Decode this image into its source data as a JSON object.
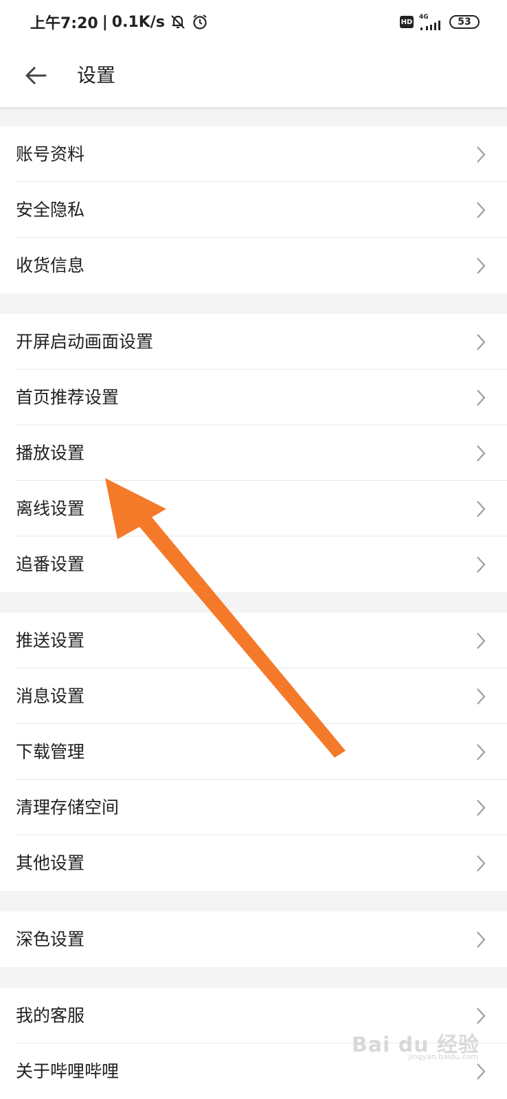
{
  "status_bar": {
    "time": "上午7:20",
    "separator": "|",
    "speed": "0.1K/s",
    "hd": "HD",
    "network": "4G",
    "battery": "53"
  },
  "header": {
    "title": "设置"
  },
  "groups": [
    {
      "items": [
        {
          "label": "账号资料"
        },
        {
          "label": "安全隐私"
        },
        {
          "label": "收货信息"
        }
      ]
    },
    {
      "items": [
        {
          "label": "开屏启动画面设置"
        },
        {
          "label": "首页推荐设置"
        },
        {
          "label": "播放设置"
        },
        {
          "label": "离线设置"
        },
        {
          "label": "追番设置"
        }
      ]
    },
    {
      "items": [
        {
          "label": "推送设置"
        },
        {
          "label": "消息设置"
        },
        {
          "label": "下载管理"
        },
        {
          "label": "清理存储空间"
        },
        {
          "label": "其他设置"
        }
      ]
    },
    {
      "items": [
        {
          "label": "深色设置"
        }
      ]
    },
    {
      "items": [
        {
          "label": "我的客服"
        },
        {
          "label": "关于哔哩哔哩"
        }
      ]
    }
  ],
  "watermark": {
    "brand": "Bai du 经验",
    "url": "jingyan.baidu.com"
  },
  "colors": {
    "arrow": "#f47a2a",
    "background": "#f4f4f4",
    "chevron": "#9e9e9e"
  }
}
